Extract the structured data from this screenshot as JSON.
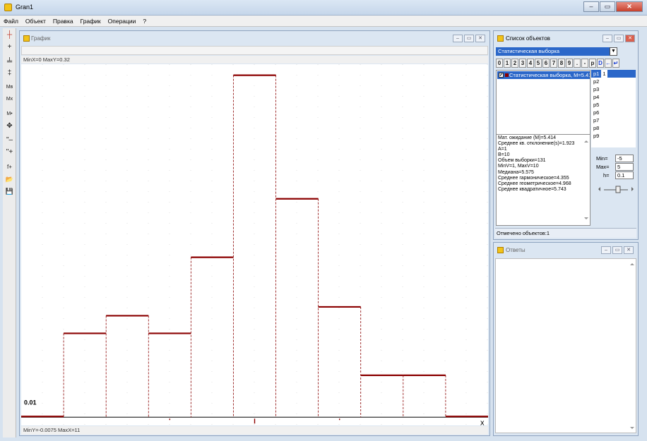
{
  "app": {
    "title": "Gran1"
  },
  "window_buttons": {
    "minimize": "‒",
    "maximize": "▭",
    "close": "✕"
  },
  "menu": [
    "Файл",
    "Объект",
    "Правка",
    "График",
    "Операции",
    "?"
  ],
  "toolbar": [
    "┼",
    "+",
    "╧",
    "‡",
    "Mв",
    "Mх",
    "M•",
    "✥",
    "\"‒",
    "\"+",
    "f+",
    "📂",
    "💾"
  ],
  "graph_window": {
    "title": "График",
    "top_info": "MinX=0  MaxY=0.32",
    "bottom_info": "MinY=-0.0075  MaxX=11",
    "y_tick_label": "0.01",
    "x_axis_marker": "x"
  },
  "object_list": {
    "title": "Список объектов",
    "selected_type": "Статистическая выборка",
    "tools": [
      "0",
      "1",
      "2",
      "3",
      "4",
      "5",
      "6",
      "7",
      "8",
      "9",
      ".",
      "-",
      "p",
      "D",
      "←",
      "↵"
    ],
    "items": [
      {
        "label": "Статистическая выборка, M=5.414",
        "checked": "✔"
      }
    ],
    "params": [
      {
        "name": "p1",
        "value": "1"
      },
      {
        "name": "p2",
        "value": ""
      },
      {
        "name": "p3",
        "value": ""
      },
      {
        "name": "p4",
        "value": ""
      },
      {
        "name": "p5",
        "value": ""
      },
      {
        "name": "p6",
        "value": ""
      },
      {
        "name": "p7",
        "value": ""
      },
      {
        "name": "p8",
        "value": ""
      },
      {
        "name": "p9",
        "value": ""
      }
    ],
    "stats": [
      "Мат. ожидание (M)=5.414",
      "Среднее кв. отклонение(s)=1.923",
      "A=1",
      "B=10",
      "Объем выборки=131",
      "MinV=1, MaxV=10",
      "Медиана=5.575",
      "Среднее гармоническое=4.355",
      "Среднее геометрическое=4.968",
      "Среднее квадратичное=5.743"
    ],
    "min_label": "Min=",
    "min_value": "-5",
    "max_label": "Max=",
    "max_value": "5",
    "h_label": "h=",
    "h_value": "0.1",
    "status": "Отмечено объектов:1"
  },
  "answers_window": {
    "title": "Ответы"
  },
  "chart_data": {
    "type": "bar",
    "x": [
      0,
      1,
      2,
      3,
      4,
      5,
      6,
      7,
      8,
      9,
      10
    ],
    "bin_edges": [
      1,
      2,
      3,
      4,
      5,
      6,
      7,
      8,
      9,
      10
    ],
    "values": [
      0.076,
      0.092,
      0.076,
      0.145,
      0.31,
      0.198,
      0.1,
      0.038,
      0.038
    ],
    "xlim": [
      0,
      11
    ],
    "ylim": [
      -0.0075,
      0.32
    ],
    "ytick": 0.01,
    "grid": true,
    "color": "#8b0000"
  }
}
